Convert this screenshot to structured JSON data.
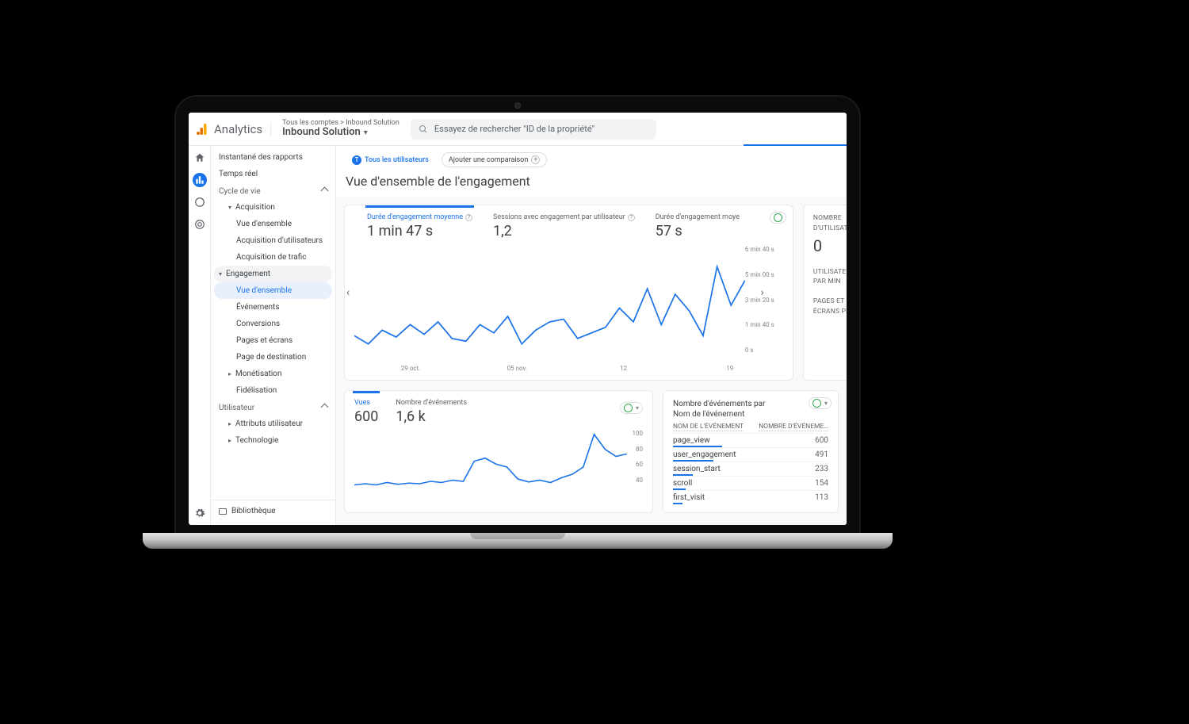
{
  "header": {
    "product": "Analytics",
    "breadcrumb": "Tous les comptes > Inbound Solution",
    "property": "Inbound Solution",
    "search_placeholder": "Essayez de rechercher \"ID de la propriété\""
  },
  "chips": {
    "all_users": "Tous les utilisateurs",
    "add_comparison": "Ajouter une comparaison"
  },
  "page_title": "Vue d'ensemble de l'engagement",
  "sidebar": {
    "snapshot": "Instantané des rapports",
    "realtime": "Temps réel",
    "lifecycle": "Cycle de vie",
    "acquisition": "Acquisition",
    "acq_overview": "Vue d'ensemble",
    "acq_users": "Acquisition d'utilisateurs",
    "acq_traffic": "Acquisition de trafic",
    "engagement": "Engagement",
    "eng_overview": "Vue d'ensemble",
    "events": "Événements",
    "conversions": "Conversions",
    "pages": "Pages et écrans",
    "landing": "Page de destination",
    "monetisation": "Monétisation",
    "retention": "Fidélisation",
    "user_section": "Utilisateur",
    "user_attrs": "Attributs utilisateur",
    "tech": "Technologie",
    "library": "Bibliothèque"
  },
  "metrics": [
    {
      "label": "Durée d'engagement moyenne",
      "value": "1 min 47 s"
    },
    {
      "label": "Sessions avec engagement par utilisateur",
      "value": "1,2"
    },
    {
      "label": "Durée d'engagement moye",
      "value": "57 s"
    }
  ],
  "side_cards": {
    "users_h": "NOMBRE D'UTILISATEUR",
    "users_v": "0",
    "per_min": "UTILISATEURS PAR MIN",
    "pages": "PAGES ET ÉCRANS PR"
  },
  "metrics2": [
    {
      "label": "Vues",
      "value": "600"
    },
    {
      "label": "Nombre d'événements",
      "value": "1,6 k"
    }
  ],
  "table": {
    "title1": "Nombre d'événements par",
    "title2": "Nom de l'événement",
    "col1": "NOM DE L'ÉVÉNEMENT",
    "col2": "NOMBRE D'ÉVÉNEME…",
    "rows": [
      {
        "name": "page_view",
        "value": "600",
        "w": 40
      },
      {
        "name": "user_engagement",
        "value": "491",
        "w": 33
      },
      {
        "name": "session_start",
        "value": "233",
        "w": 16
      },
      {
        "name": "scroll",
        "value": "154",
        "w": 10
      },
      {
        "name": "first_visit",
        "value": "113",
        "w": 8
      }
    ]
  },
  "chart_data": [
    {
      "type": "line",
      "title": "Durée d'engagement moyenne",
      "x_ticks": [
        "29 oct.",
        "05 nov.",
        "12",
        "19"
      ],
      "y_ticks": [
        "6 min 40 s",
        "5 min 00 s",
        "3 min 20 s",
        "1 min 40 s",
        "0 s"
      ],
      "ylim_seconds": [
        0,
        400
      ],
      "series": [
        {
          "name": "Durée d'engagement moyenne",
          "color": "#1a73e8",
          "values_seconds": [
            90,
            60,
            110,
            85,
            130,
            95,
            140,
            80,
            70,
            130,
            100,
            160,
            60,
            110,
            140,
            150,
            80,
            100,
            120,
            190,
            140,
            260,
            130,
            240,
            180,
            90,
            340,
            200,
            290
          ]
        }
      ]
    },
    {
      "type": "line",
      "title": "Vues",
      "y_ticks": [
        "100",
        "80",
        "60",
        "40"
      ],
      "ylim": [
        0,
        100
      ],
      "series": [
        {
          "name": "Vues",
          "color": "#1a73e8",
          "values": [
            10,
            12,
            10,
            14,
            11,
            13,
            12,
            16,
            14,
            18,
            16,
            50,
            55,
            45,
            40,
            20,
            15,
            18,
            14,
            22,
            28,
            40,
            95,
            70,
            58,
            62
          ]
        }
      ]
    }
  ]
}
